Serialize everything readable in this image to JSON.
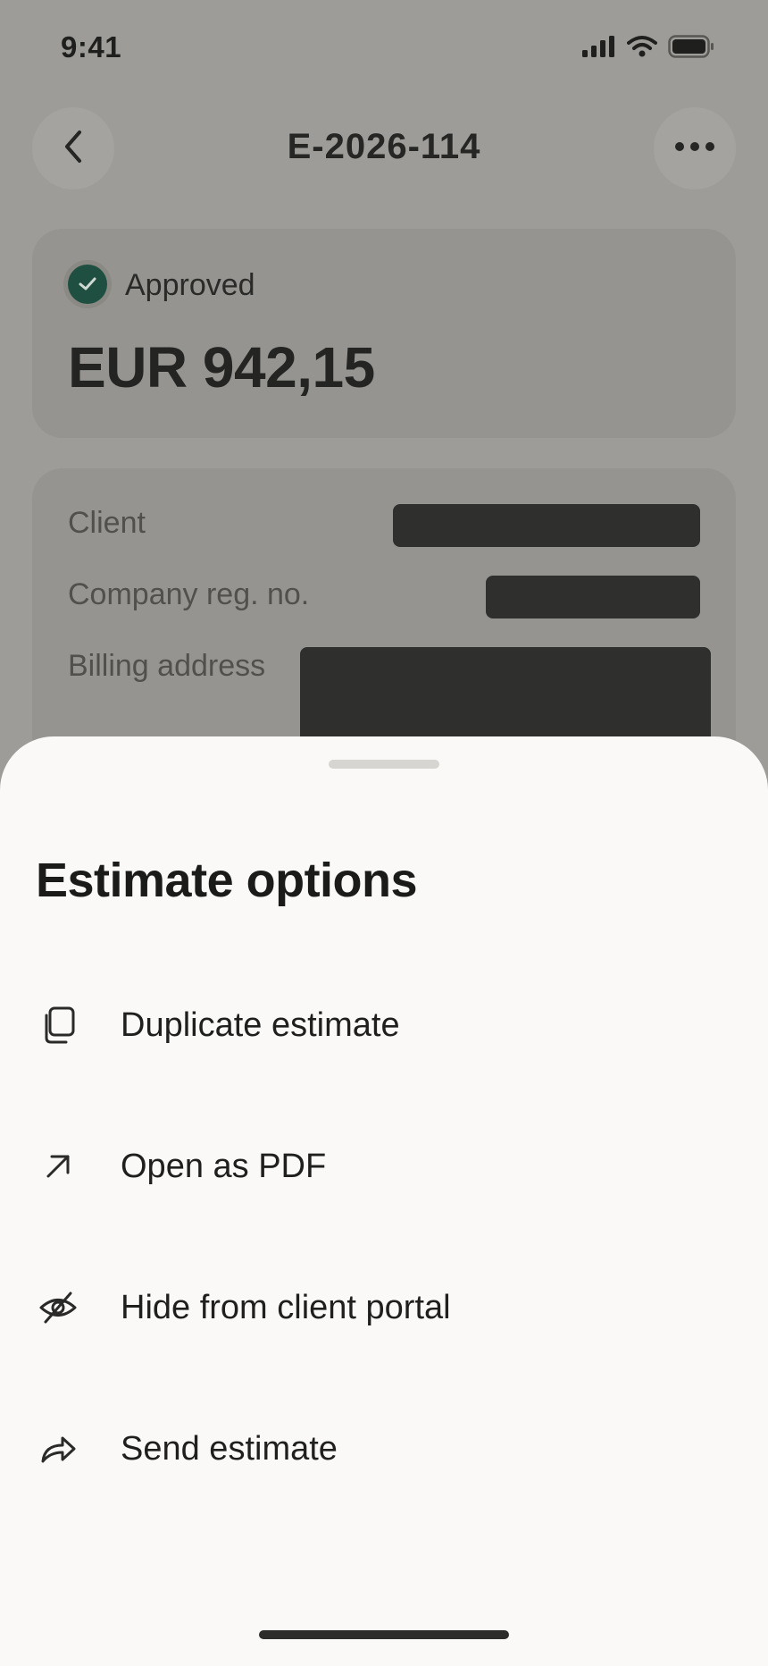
{
  "status_bar": {
    "time": "9:41"
  },
  "nav": {
    "title": "E-2026-114"
  },
  "summary": {
    "status": "Approved",
    "amount": "EUR 942,15",
    "status_color": "#1e4f40"
  },
  "details": {
    "client_label": "Client",
    "reg_label": "Company reg. no.",
    "billing_label": "Billing address"
  },
  "sheet": {
    "title": "Estimate options",
    "options": [
      {
        "label": "Duplicate estimate",
        "icon": "copy-icon"
      },
      {
        "label": "Open as PDF",
        "icon": "arrow-up-right-icon"
      },
      {
        "label": "Hide from client portal",
        "icon": "eye-off-icon"
      },
      {
        "label": "Send estimate",
        "icon": "share-arrow-icon"
      }
    ]
  }
}
